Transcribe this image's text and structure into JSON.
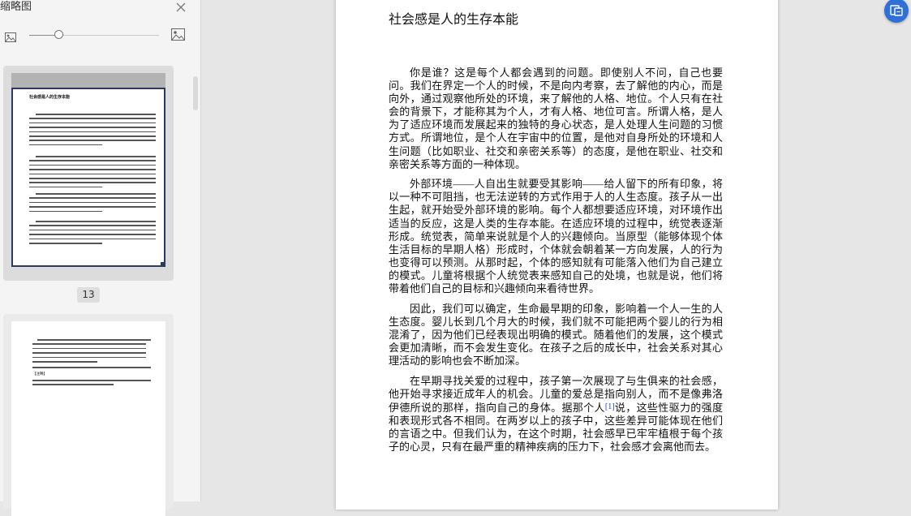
{
  "thumbnail_panel": {
    "title": "缩略图",
    "current_page_label": "13",
    "thumb1_title": "社会感是人的生存本能",
    "thumb2_footnote_label": "【注释】",
    "zoom_level": 0.23
  },
  "document": {
    "title": "社会感是人的生存本能",
    "paragraphs": [
      "你是谁？这是每个人都会遇到的问题。即使别人不问，自己也要问。我们在界定一个人的时候，不是向内考察，去了解他的内心，而是向外，通过观察他所处的环境，来了解他的人格、地位。个人只有在社会的背景下，才能称其为个人，才有人格、地位可言。所谓人格，是人为了适应环境而发展起来的独特的身心状态，是人处理人生问题的习惯方式。所谓地位，是个人在宇宙中的位置，是他对自身所处的环境和人生问题（比如职业、社交和亲密关系等）的态度，是他在职业、社交和亲密关系等方面的一种体现。",
      "外部环境——人自出生就要受其影响——给人留下的所有印象，将以一种不可阻挡，也无法逆转的方式作用于人的人生态度。孩子从一出生起，就开始受外部环境的影响。每个人都想要适应环境，对环境作出适当的反应，这是人类的生存本能。在适应环境的过程中，统觉表逐渐形成。统觉表，简单来说就是个人的兴趣倾向。当原型（能够体现个体生活目标的早期人格）形成时，个体就会朝着某一方向发展，人的行为也变得可以预测。从那时起，个体的感知就有可能落入他们为自己建立的模式。儿童将根据个人统觉表来感知自己的处境，也就是说，他们将带着他们自己的目标和兴趣倾向来看待世界。",
      "因此，我们可以确定，生命最早期的印象，影响着一个人一生的人生态度。婴儿长到几个月大的时候，我们就不可能把两个婴儿的行为相混淆了，因为他们已经表现出明确的模式。随着他们的发展，这个模式会更加清晰，而不会发生变化。在孩子之后的成长中，社会关系对其心理活动的影响也会不断加深。"
    ],
    "last_paragraph": {
      "before": "在早期寻找关爱的过程中，孩子第一次展现了与生俱来的社会感，他开始寻求接近成年人的机会。儿童的爱总是指向别人，而不是像弗洛伊德所说的那样，指向自己的身体。据那个人",
      "footnote": "[1]",
      "after": "说，这些性驱力的强度和表现形式各不相同。在两岁以上的孩子中，这些差异可能体现在他们的言语之中。但我们认为，在这个时期，社会感早已牢牢植根于每个孩子的心灵，只有在最严重的精神疾病的压力下，社会感才会离他而去。"
    }
  },
  "colors": {
    "accent": "#2e6fd8",
    "footnote": "#1a3fd1",
    "thumb_selected_border": "#2c3a63"
  },
  "icons": [
    "close-icon",
    "image-small-icon",
    "image-large-icon",
    "reading-mode-icon"
  ]
}
